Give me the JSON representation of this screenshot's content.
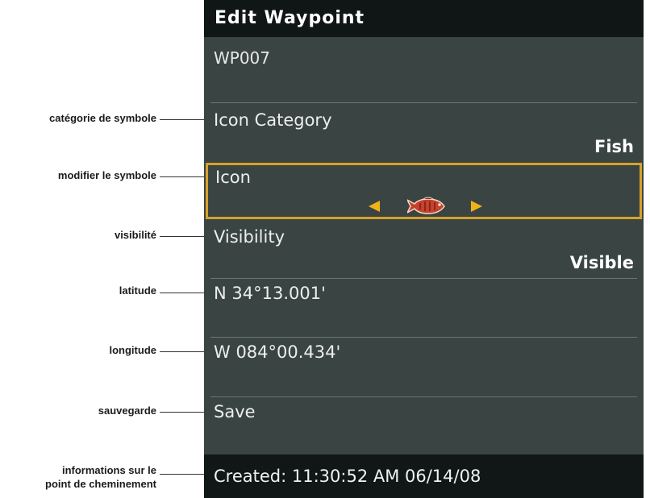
{
  "annotations": {
    "icon_category": "catégorie de symbole",
    "icon": "modifier le symbole",
    "visibility": "visibilité",
    "latitude": "latitude",
    "longitude": "longitude",
    "save": "sauvegarde",
    "info_line1": "informations sur le",
    "info_line2": "point de cheminement"
  },
  "screen": {
    "title": "Edit Waypoint",
    "waypoint_name": "WP007",
    "icon_category": {
      "label": "Icon Category",
      "value": "Fish"
    },
    "icon": {
      "label": "Icon",
      "symbol": "fish-icon"
    },
    "visibility": {
      "label": "Visibility",
      "value": "Visible"
    },
    "latitude": "N 34°13.001'",
    "longitude": "W 084°00.434'",
    "save": "Save",
    "created": "Created: 11:30:52 AM 06/14/08"
  },
  "colors": {
    "screen_bg": "#3a4443",
    "bar_bg": "#101516",
    "highlight": "#d7a22a",
    "arrow": "#f0b21b",
    "fish": "#c8412c"
  }
}
